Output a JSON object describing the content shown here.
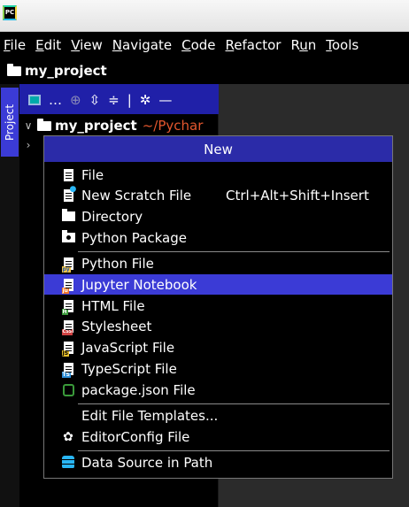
{
  "window": {
    "logo_text": "PC"
  },
  "menubar": {
    "items": [
      {
        "mnemonic": "F",
        "rest": "ile"
      },
      {
        "mnemonic": "E",
        "rest": "dit"
      },
      {
        "mnemonic": "V",
        "rest": "iew"
      },
      {
        "mnemonic": "N",
        "rest": "avigate"
      },
      {
        "mnemonic": "C",
        "rest": "ode"
      },
      {
        "mnemonic": "R",
        "rest": "efactor"
      },
      {
        "mnemonic": "R",
        "rest": "un",
        "pre": "R",
        "mid": "u",
        "post": "n"
      },
      {
        "mnemonic": "T",
        "rest": "ools"
      }
    ]
  },
  "navbar": {
    "project_name": "my_project"
  },
  "sidebar": {
    "project_tab_label": "Project"
  },
  "project_panel": {
    "root_name": "my_project",
    "root_path": "~/Pychar"
  },
  "popup": {
    "title": "New",
    "items": [
      {
        "label": "File",
        "icon": "file-icon"
      },
      {
        "label": "New Scratch File",
        "shortcut": "Ctrl+Alt+Shift+Insert",
        "icon": "scratch-file-icon"
      },
      {
        "label": "Directory",
        "icon": "folder-icon"
      },
      {
        "label": "Python Package",
        "icon": "python-package-icon"
      },
      {
        "label": "Python File",
        "icon": "python-file-icon"
      },
      {
        "label": "Jupyter Notebook",
        "icon": "jupyter-notebook-icon",
        "selected": true
      },
      {
        "label": "HTML File",
        "icon": "html-file-icon",
        "badge": "H"
      },
      {
        "label": "Stylesheet",
        "icon": "stylesheet-icon",
        "badge": "CSS"
      },
      {
        "label": "JavaScript File",
        "icon": "javascript-file-icon",
        "badge": "JS"
      },
      {
        "label": "TypeScript File",
        "icon": "typescript-file-icon",
        "badge": "TS"
      },
      {
        "label": "package.json File",
        "icon": "nodejs-icon"
      },
      {
        "label": "Edit File Templates...",
        "icon": ""
      },
      {
        "label": "EditorConfig File",
        "icon": "gear-icon"
      },
      {
        "label": "Data Source in Path",
        "icon": "database-icon"
      }
    ]
  },
  "colors": {
    "selection": "#3b3bd6",
    "title_bar": "#2b2ba8",
    "path_text": "#e4572e"
  }
}
